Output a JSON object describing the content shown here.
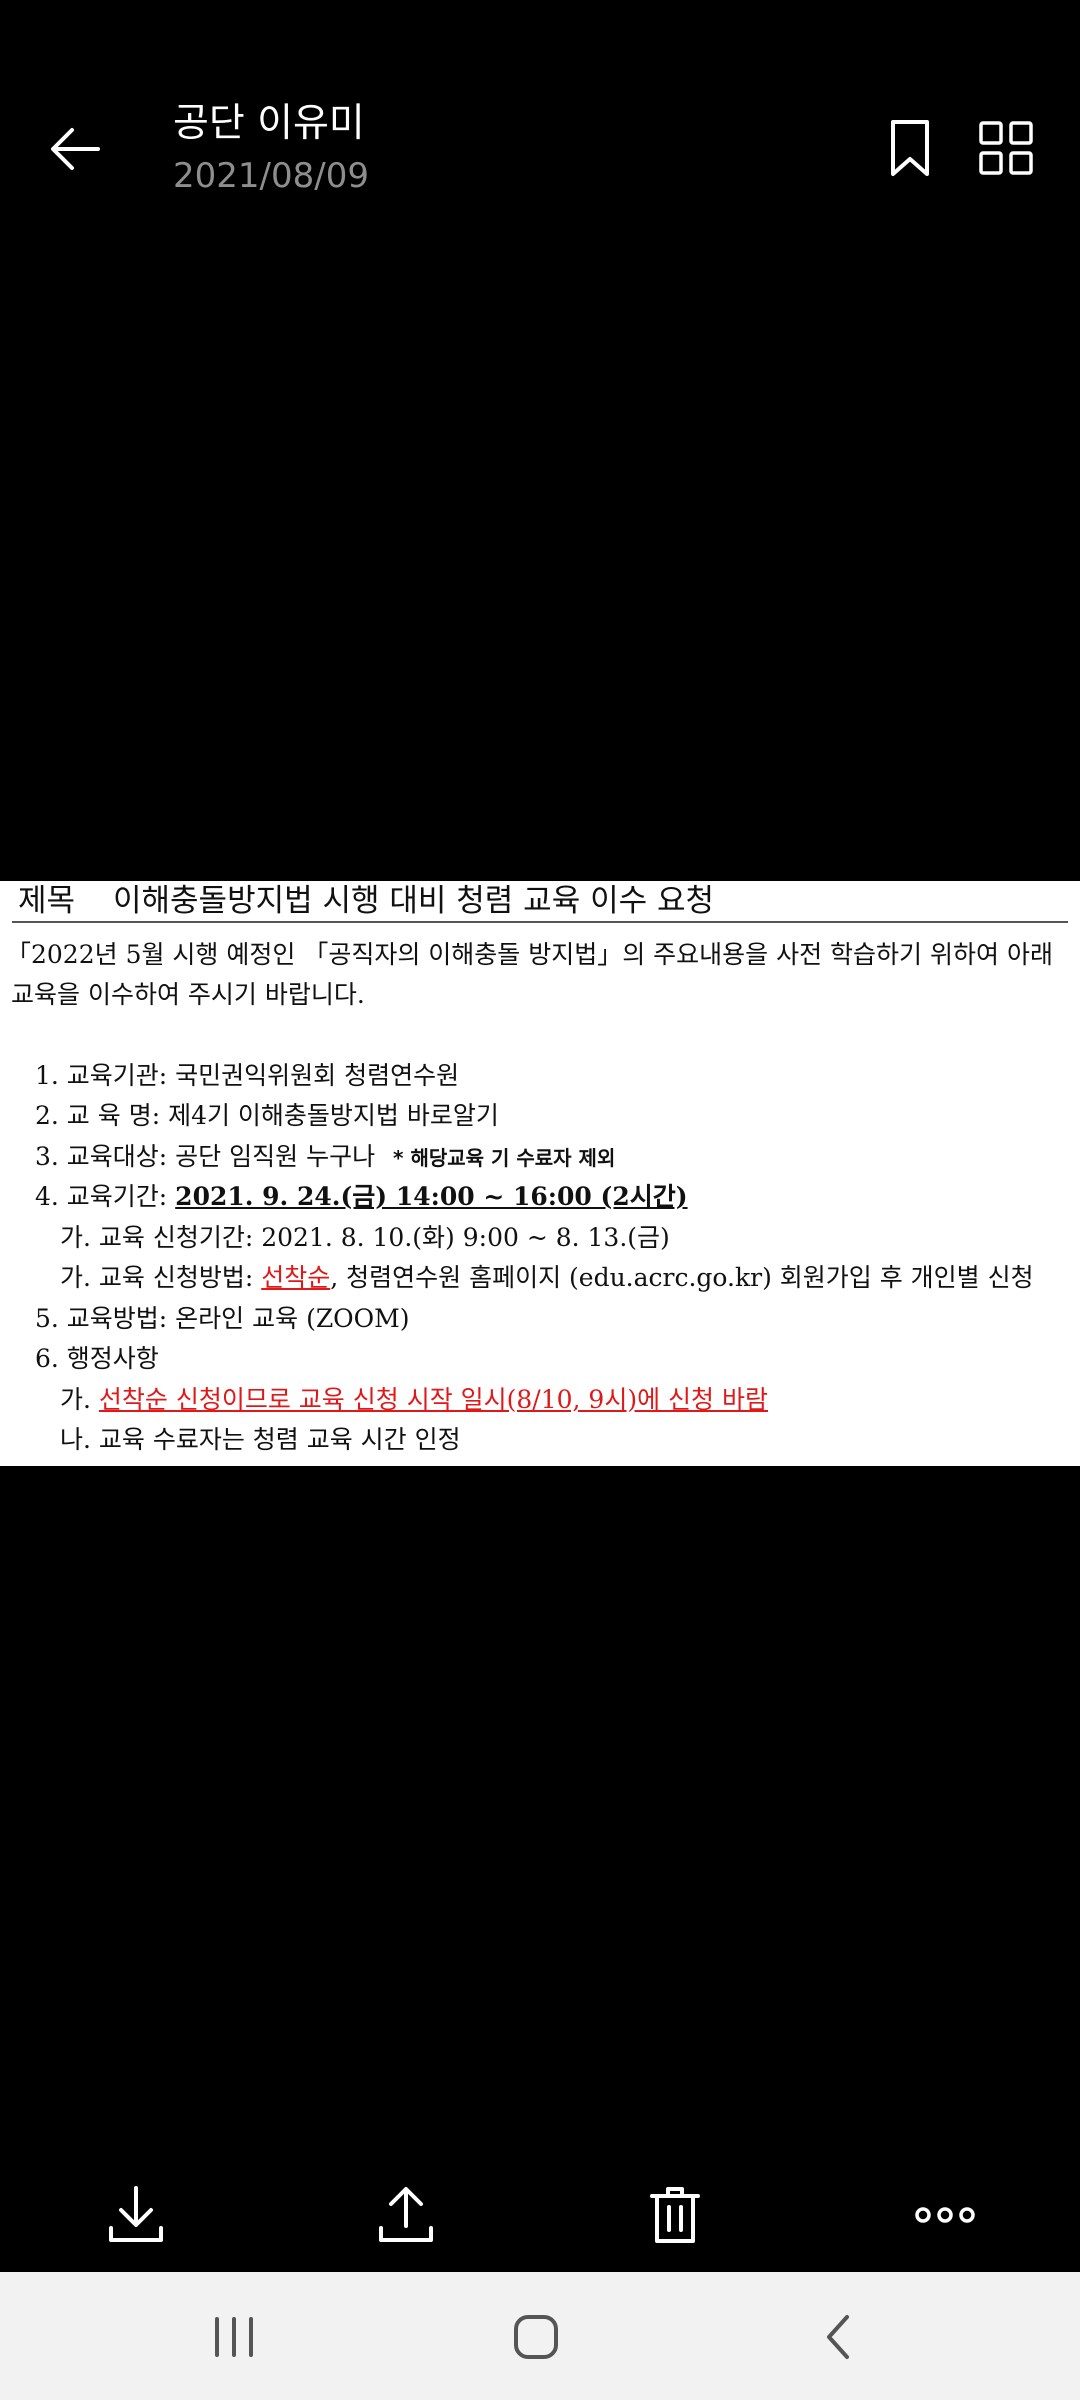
{
  "header": {
    "title": "공단 이유미",
    "date": "2021/08/09"
  },
  "icons": {
    "back": "arrow-left-icon",
    "bookmark": "bookmark-icon",
    "grid": "grid-icon",
    "download": "download-icon",
    "share": "share-icon",
    "delete": "trash-icon",
    "more": "more-horizontal-icon",
    "recents": "recents-icon",
    "home": "home-icon",
    "nav_back": "nav-back-icon"
  },
  "document": {
    "subject_label": "제목",
    "subject": "이해충돌방지법 시행 대비 청렴 교육 이수 요청",
    "intro_line1": "「2022년 5월 시행 예정인 「공직자의 이해충돌 방지법」의 주요내용을 사전 학습하기 위하여 아래",
    "intro_line2": "교육을 이수하여 주시기 바랍니다.",
    "item1": "1. 교육기관: 국민권익위원회 청렴연수원",
    "item2": "2. 교 육 명: 제4기 이해충돌방지법 바로알기",
    "item3_text": "3. 교육대상: 공단 임직원 누구나",
    "item3_note": "* 해당교육 기 수료자 제외",
    "item4_label": "4. 교육기간: ",
    "item4_value": "2021. 9. 24.(금) 14:00 ~ 16:00 (2시간)",
    "item4a": "가. 교육 신청기간: 2021. 8. 10.(화) 9:00 ~ 8. 13.(금)",
    "item4b_label": "가. 교육 신청방법: ",
    "item4b_red": "선착순",
    "item4b_rest": ", 청렴연수원 홈페이지 (edu.acrc.go.kr) 회원가입 후 개인별 신청",
    "item5": "5. 교육방법: 온라인 교육 (ZOOM)",
    "item6": "6. 행정사항",
    "item6a_label": "가. ",
    "item6a_red": "선착순 신청이므로 교육 신청 시작 일시(8/10, 9시)에 신청 바람",
    "item6b": "나. 교육 수료자는 청렴 교육 시간 인정"
  },
  "colors": {
    "background": "#000000",
    "document_bg": "#ffffff",
    "accent_red": "#e01818",
    "date_gray": "#8e8e8e",
    "navbar_bg": "#f2f2f2"
  }
}
